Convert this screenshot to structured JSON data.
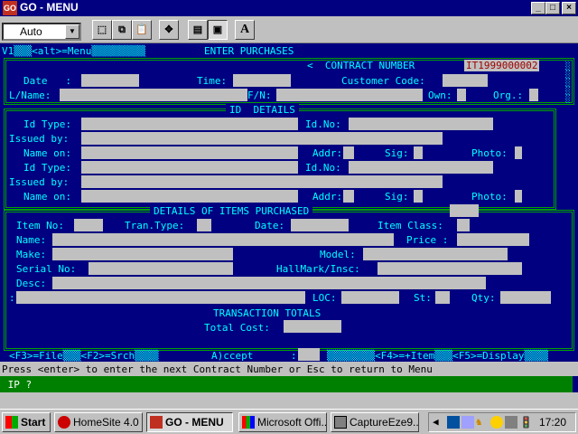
{
  "window": {
    "title": "GO - MENU",
    "app_icon_text": "GO"
  },
  "toolbar": {
    "font_combo": "Auto",
    "bold_label": "A"
  },
  "term": {
    "line1_left": "V1▒▒▒<alt>=Menu▒▒▒▒▒▒▒▒▒",
    "line1_center": "ENTER PURCHASES",
    "contract_label": "<  CONTRACT NUMBER ",
    "contract_value": "IT1999000002",
    "date_label": "Date   :",
    "time_label": "Time:",
    "customer_code_label": "Customer Code:",
    "lname_label": "L/Name:",
    "fn_label": "F/N:",
    "own_label": "Own:",
    "org_label": "Org.:",
    "id_details_title": "ID  DETAILS",
    "id_type_label": "Id Type:",
    "id_no_label": "Id.No:",
    "issued_by_label": "Issued by:",
    "name_on_label": "Name on:",
    "addr_label": "Addr:",
    "sig_label": "Sig:",
    "photo_label": "Photo:",
    "items_title": "DETAILS OF ITEMS PURCHASED",
    "item_no_label": "Item No:",
    "tran_type_label": "Tran.Type:",
    "date2_label": "Date:",
    "item_class_label": "Item Class:",
    "name_label": "Name:",
    "price_label": "Price :",
    "make_label": "Make:",
    "model_label": "Model:",
    "serial_label": "Serial No:",
    "hallmark_label": "HallMark/Insc:",
    "desc_label": "Desc:",
    "colon_label": ":",
    "loc_label": "LOC:",
    "st_label": "St:",
    "qty_label": "Qty:",
    "totals_title": "TRANSACTION TOTALS",
    "total_cost_label": "Total Cost:",
    "fkeys_left": "<F3>=File▒▒▒<F2>=Srch▒▒▒▒",
    "accept_label": "A)ccept",
    "accept_colon": ":",
    "fkeys_right": "▒▒▒▒▒▒▒▒<F4>=+Item▒▒▒<F5>=Display▒▒▒▒",
    "side_chars": "░\n░\n░\n░\n░"
  },
  "status_text": "Press <enter> to enter the next Contract Number or Esc to return to Menu",
  "input_text": " IP ?",
  "taskbar": {
    "start": "Start",
    "tasks": [
      "HomeSite 4.0",
      "GO - MENU",
      "Microsoft Offi...",
      "CaptureEze9..."
    ],
    "clock": "17:20"
  },
  "colors": {
    "terminal_bg": "#000080",
    "label": "#00ffff",
    "field": "#c0c0c0",
    "frame": "#00a000",
    "input_bg": "#008000"
  }
}
